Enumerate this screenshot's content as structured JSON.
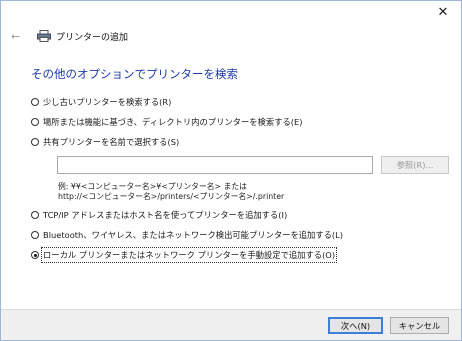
{
  "window": {
    "title": "プリンターの追加",
    "close_glyph": "✕",
    "back_glyph": "←"
  },
  "heading": "その他のオプションでプリンターを検索",
  "options": [
    {
      "label": "少し古いプリンターを検索する(R)",
      "selected": false
    },
    {
      "label": "場所または機能に基づき、ディレクトリ内のプリンターを検索する(E)",
      "selected": false
    },
    {
      "label": "共有プリンターを名前で選択する(S)",
      "selected": false
    },
    {
      "label": "TCP/IP アドレスまたはホスト名を使ってプリンターを追加する(I)",
      "selected": false
    },
    {
      "label": "Bluetooth、ワイヤレス、またはネットワーク検出可能プリンターを追加する(L)",
      "selected": false
    },
    {
      "label": "ローカル プリンターまたはネットワーク プリンターを手動設定で追加する(O)",
      "selected": true
    }
  ],
  "share": {
    "input_value": "",
    "browse_label": "参照(R)...",
    "example_line1": "例: ¥¥<コンピューター名>¥<プリンター名> または",
    "example_line2": "http://<コンピューター名>/printers/<プリンター名>/.printer"
  },
  "footer": {
    "next_label": "次へ(N)",
    "cancel_label": "キャンセル"
  },
  "colors": {
    "heading": "#1e3aa6",
    "frame_border": "#9fb6d4",
    "default_button_border": "#3c7fd6"
  }
}
